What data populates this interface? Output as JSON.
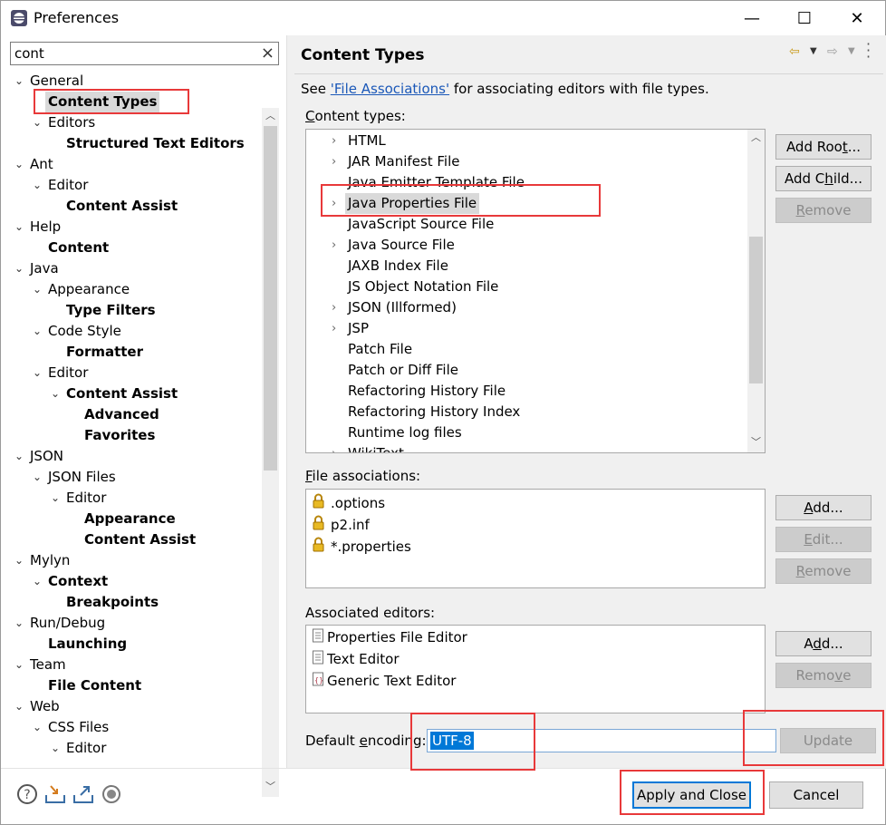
{
  "window": {
    "title": "Preferences",
    "minimize_symbol": "—",
    "maximize_symbol": "☐",
    "close_symbol": "✕"
  },
  "filter": {
    "value": "cont",
    "clear_symbol": "×"
  },
  "tree": [
    {
      "label": "General",
      "depth": 0,
      "expanded": true,
      "bold": false
    },
    {
      "label": "Content Types",
      "depth": 1,
      "bold": true,
      "selected": true
    },
    {
      "label": "Editors",
      "depth": 1,
      "expanded": true,
      "bold": false
    },
    {
      "label": "Structured Text Editors",
      "depth": 2,
      "bold": true
    },
    {
      "label": "Ant",
      "depth": 0,
      "expanded": true,
      "bold": false
    },
    {
      "label": "Editor",
      "depth": 1,
      "expanded": true,
      "bold": false
    },
    {
      "label": "Content Assist",
      "depth": 2,
      "bold": true
    },
    {
      "label": "Help",
      "depth": 0,
      "expanded": true,
      "bold": false
    },
    {
      "label": "Content",
      "depth": 1,
      "bold": true
    },
    {
      "label": "Java",
      "depth": 0,
      "expanded": true,
      "bold": false
    },
    {
      "label": "Appearance",
      "depth": 1,
      "expanded": true,
      "bold": false
    },
    {
      "label": "Type Filters",
      "depth": 2,
      "bold": true
    },
    {
      "label": "Code Style",
      "depth": 1,
      "expanded": true,
      "bold": false
    },
    {
      "label": "Formatter",
      "depth": 2,
      "bold": true
    },
    {
      "label": "Editor",
      "depth": 1,
      "expanded": true,
      "bold": false
    },
    {
      "label": "Content Assist",
      "depth": 2,
      "expanded": true,
      "bold": true
    },
    {
      "label": "Advanced",
      "depth": 3,
      "bold": true
    },
    {
      "label": "Favorites",
      "depth": 3,
      "bold": true
    },
    {
      "label": "JSON",
      "depth": 0,
      "expanded": true,
      "bold": false
    },
    {
      "label": "JSON Files",
      "depth": 1,
      "expanded": true,
      "bold": false
    },
    {
      "label": "Editor",
      "depth": 2,
      "expanded": true,
      "bold": false
    },
    {
      "label": "Appearance",
      "depth": 3,
      "bold": true
    },
    {
      "label": "Content Assist",
      "depth": 3,
      "bold": true
    },
    {
      "label": "Mylyn",
      "depth": 0,
      "expanded": true,
      "bold": false
    },
    {
      "label": "Context",
      "depth": 1,
      "expanded": true,
      "bold": true
    },
    {
      "label": "Breakpoints",
      "depth": 2,
      "bold": true
    },
    {
      "label": "Run/Debug",
      "depth": 0,
      "expanded": true,
      "bold": false
    },
    {
      "label": "Launching",
      "depth": 1,
      "bold": true
    },
    {
      "label": "Team",
      "depth": 0,
      "expanded": true,
      "bold": false
    },
    {
      "label": "File Content",
      "depth": 1,
      "bold": true
    },
    {
      "label": "Web",
      "depth": 0,
      "expanded": true,
      "bold": false
    },
    {
      "label": "CSS Files",
      "depth": 1,
      "expanded": true,
      "bold": false
    },
    {
      "label": "Editor",
      "depth": 2,
      "expanded": true,
      "bold": false
    }
  ],
  "page": {
    "title": "Content Types",
    "see_prefix": "See ",
    "see_link": "'File Associations'",
    "see_suffix": " for associating editors with file types."
  },
  "content_types": {
    "label_mnemonic": "C",
    "label_rest": "ontent types:",
    "items": [
      {
        "label": "HTML",
        "expandable": true
      },
      {
        "label": "JAR Manifest File",
        "expandable": true
      },
      {
        "label": "Java Emitter Template File",
        "expandable": false
      },
      {
        "label": "Java Properties File",
        "expandable": true,
        "selected": true
      },
      {
        "label": "JavaScript Source File",
        "expandable": false
      },
      {
        "label": "Java Source File",
        "expandable": true
      },
      {
        "label": "JAXB Index File",
        "expandable": false
      },
      {
        "label": "JS Object Notation File",
        "expandable": false
      },
      {
        "label": "JSON (Illformed)",
        "expandable": true
      },
      {
        "label": "JSP",
        "expandable": true
      },
      {
        "label": "Patch File",
        "expandable": false
      },
      {
        "label": "Patch or Diff File",
        "expandable": false
      },
      {
        "label": "Refactoring History File",
        "expandable": false
      },
      {
        "label": "Refactoring History Index",
        "expandable": false
      },
      {
        "label": "Runtime log files",
        "expandable": false
      },
      {
        "label": "WikiText",
        "expandable": true
      }
    ],
    "buttons": {
      "add_root": {
        "pre": "Add Roo",
        "mn": "t",
        "post": "..."
      },
      "add_child": {
        "pre": "Add C",
        "mn": "h",
        "post": "ild..."
      },
      "remove": {
        "pre": "",
        "mn": "R",
        "post": "emove"
      }
    }
  },
  "file_associations": {
    "label_mnemonic": "F",
    "label_rest": "ile associations:",
    "items": [
      ".options",
      "p2.inf",
      "*.properties"
    ],
    "buttons": {
      "add": {
        "pre": "",
        "mn": "A",
        "post": "dd..."
      },
      "edit": {
        "pre": "",
        "mn": "E",
        "post": "dit..."
      },
      "remove": {
        "pre": "",
        "mn": "R",
        "post": "emove"
      }
    }
  },
  "associated_editors": {
    "label": "Associated editors:",
    "items": [
      "Properties File Editor",
      "Text Editor",
      "Generic Text Editor"
    ],
    "buttons": {
      "add": {
        "pre": "A",
        "mn": "d",
        "post": "d..."
      },
      "remove": {
        "pre": "Remo",
        "mn": "v",
        "post": "e"
      }
    }
  },
  "encoding": {
    "label_pre": "Default ",
    "label_mn": "e",
    "label_post": "ncoding:",
    "value": "UTF-8",
    "update_label": "Update"
  },
  "footer": {
    "apply_close": "Apply and Close",
    "cancel": "Cancel"
  },
  "colors": {
    "highlight_red": "#e8393a",
    "selection_blue": "#0078d7",
    "link_blue": "#1b58b8"
  }
}
